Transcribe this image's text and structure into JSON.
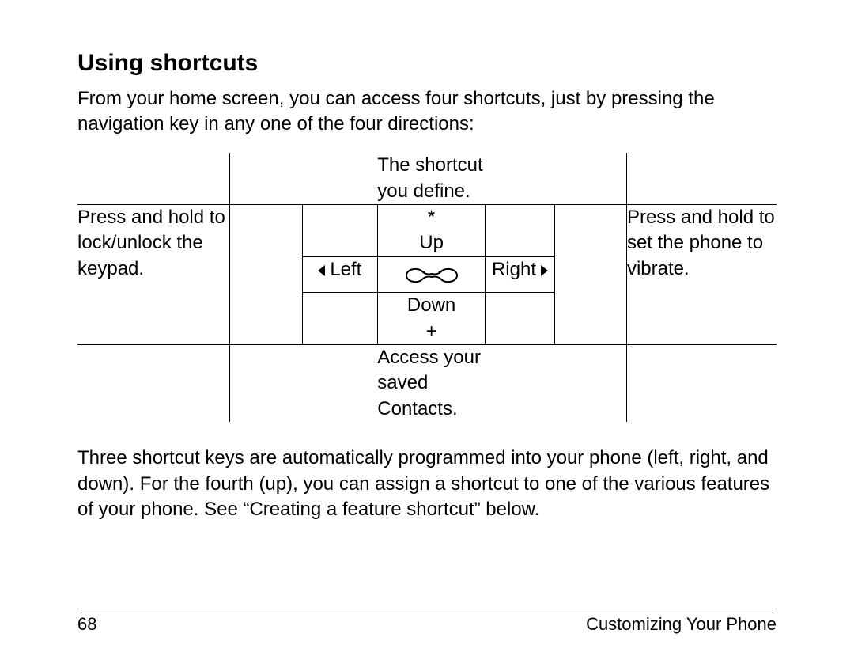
{
  "heading": "Using shortcuts",
  "intro": "From your home screen, you can access four shortcuts, just by pressing the navigation key in any one of the four directions:",
  "diagram": {
    "top_caption": "The shortcut you define.",
    "asterisk": "*",
    "up_label": "Up",
    "left_label": "Left",
    "right_label": "Right",
    "down_label": "Down",
    "plus": "+",
    "bottom_caption": "Access your saved Contacts.",
    "left_text": "Press and hold to lock/unlock the keypad.",
    "right_text": "Press and hold to set the phone to vibrate."
  },
  "body2": "Three shortcut keys are automatically programmed into your phone (left, right, and down). For the fourth (up), you can assign a shortcut to one of the various features of your phone. See “Creating a feature shortcut” below.",
  "footer": {
    "page": "68",
    "section": "Customizing Your Phone"
  }
}
